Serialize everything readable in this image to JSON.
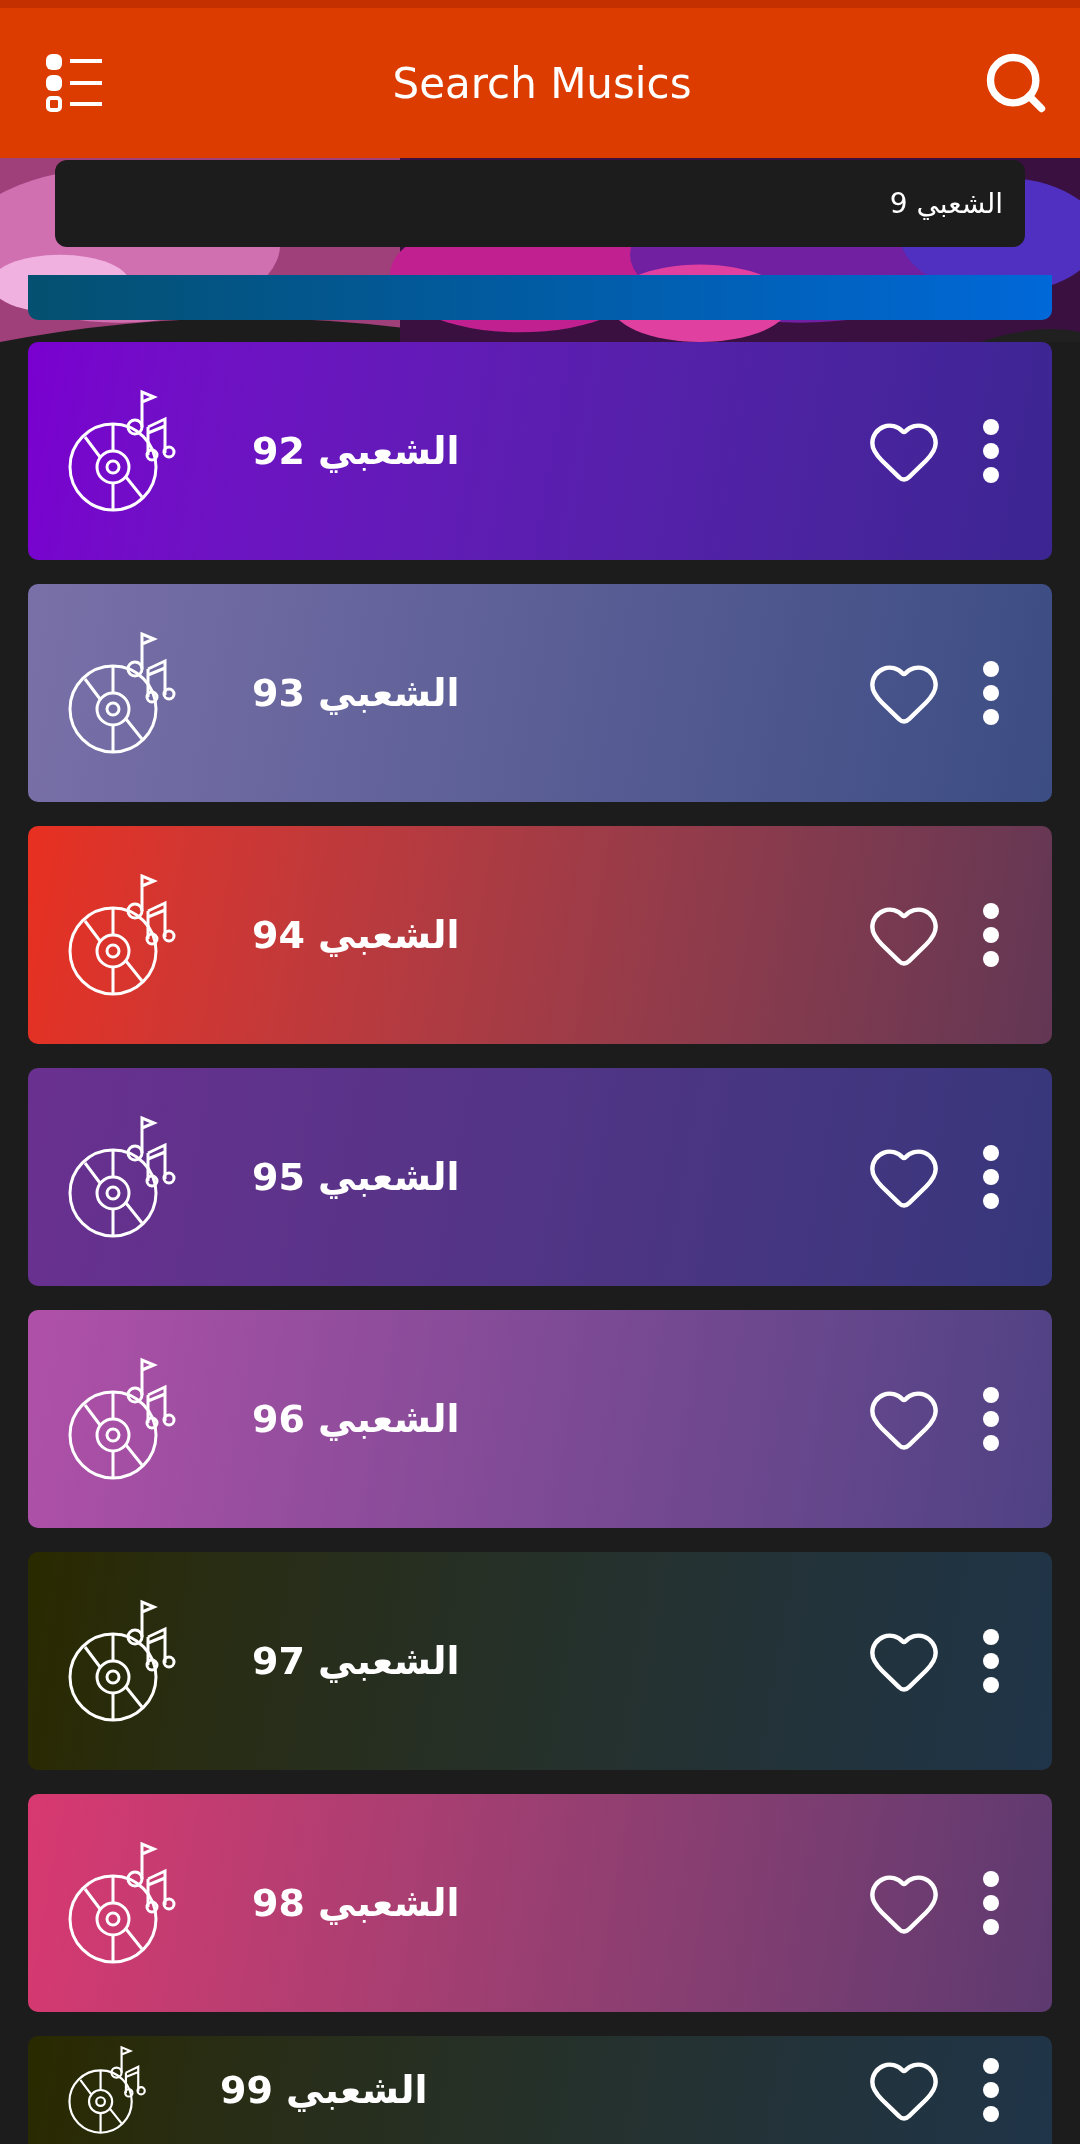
{
  "header": {
    "title": "Search Musics"
  },
  "search": {
    "value": "الشعبي 9"
  },
  "songs": [
    {
      "title": "الشعبي 92",
      "color": "#7a00d0"
    },
    {
      "title": "الشعبي 93",
      "color": "#7a70a8"
    },
    {
      "title": "الشعبي 94",
      "color": "#e83020"
    },
    {
      "title": "الشعبي 95",
      "color": "#6a3090"
    },
    {
      "title": "الشعبي 96",
      "color": "#b050a8"
    },
    {
      "title": "الشعبي 97",
      "color": "#2a2a00"
    },
    {
      "title": "الشعبي 98",
      "color": "#d83870"
    },
    {
      "title": "الشعبي 99",
      "color": "#2a2a00"
    }
  ]
}
